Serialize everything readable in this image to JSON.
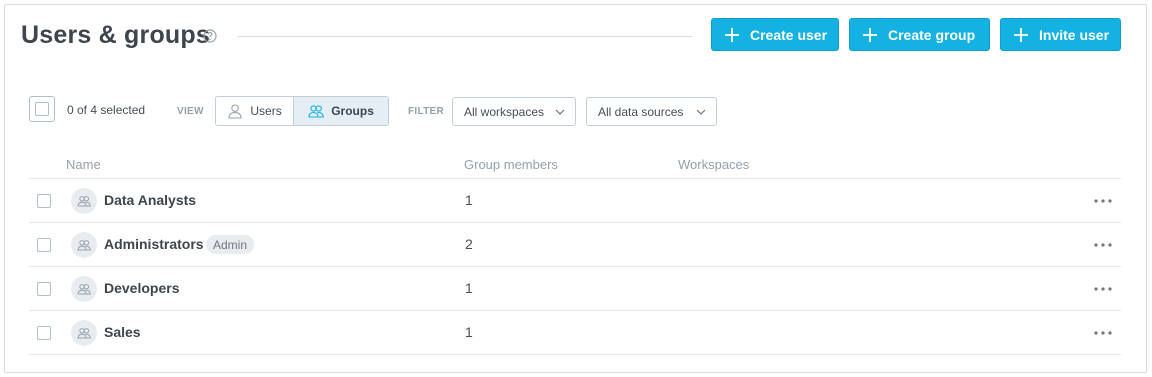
{
  "header": {
    "title": "Users & groups",
    "help_icon": "question-circle-icon",
    "buttons": {
      "create_user": "Create user",
      "create_group": "Create group",
      "invite_user": "Invite user"
    },
    "button_icon": "plus-icon",
    "accent_color": "#14b2e2"
  },
  "toolbar": {
    "selection_text": "0 of 4 selected",
    "view_label": "VIEW",
    "view_options": [
      "Users",
      "Groups"
    ],
    "view_selected": "Groups",
    "filter_label": "FILTER",
    "filters": [
      "All workspaces",
      "All data sources"
    ]
  },
  "table": {
    "columns": [
      "Name",
      "Group members",
      "Workspaces"
    ],
    "rows": [
      {
        "name": "Data Analysts",
        "badge": "",
        "members": "1",
        "workspaces": ""
      },
      {
        "name": "Administrators",
        "badge": "Admin",
        "members": "2",
        "workspaces": ""
      },
      {
        "name": "Developers",
        "badge": "",
        "members": "1",
        "workspaces": ""
      },
      {
        "name": "Sales",
        "badge": "",
        "members": "1",
        "workspaces": ""
      }
    ],
    "row_icon": "group-icon",
    "row_menu_icon": "more-horizontal-icon"
  }
}
